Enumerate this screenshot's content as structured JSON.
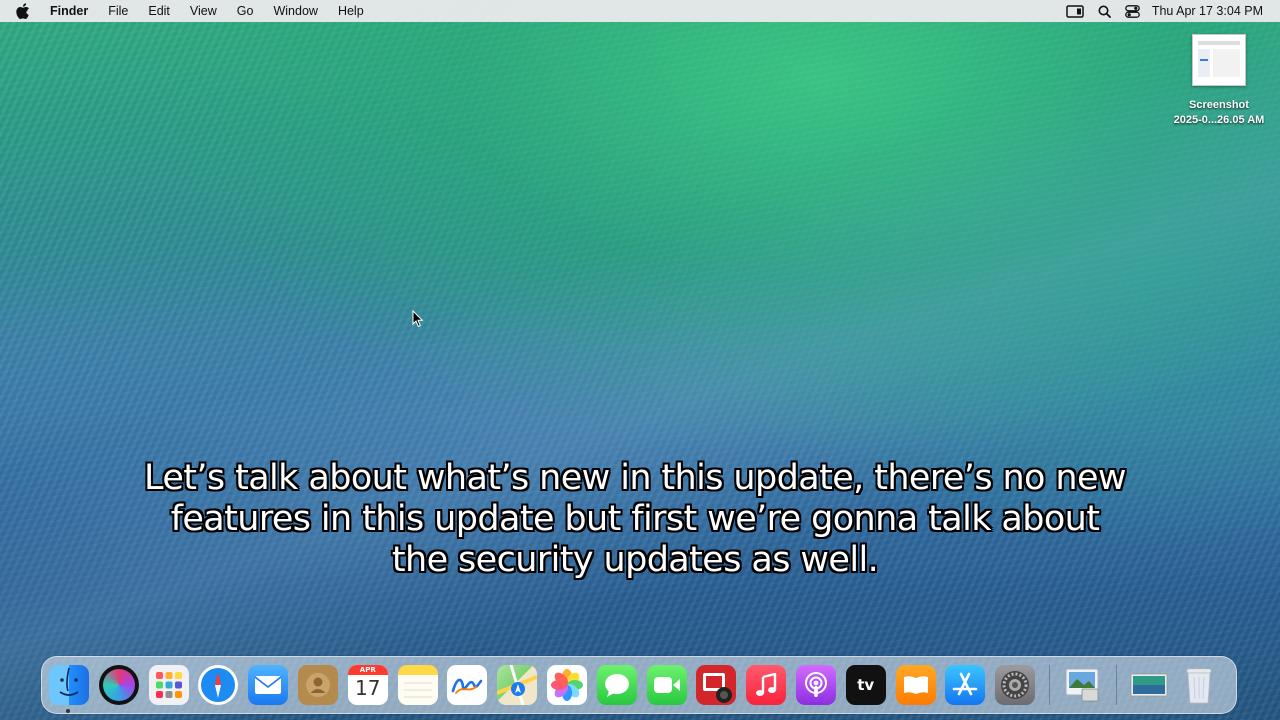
{
  "menubar": {
    "apple_icon": "apple-logo-icon",
    "app_name": "Finder",
    "items": [
      "File",
      "Edit",
      "View",
      "Go",
      "Window",
      "Help"
    ],
    "status_icons": [
      "screen-mirroring-icon",
      "spotlight-search-icon",
      "control-center-icon"
    ],
    "clock": "Thu Apr 17  3:04 PM"
  },
  "desktop": {
    "file": {
      "name_line1": "Screenshot",
      "name_line2": "2025-0...26.05 AM"
    }
  },
  "caption": {
    "text": "Let’s talk about what’s new in this update, there’s no new features in this update but first we’re gonna talk about the security updates as well."
  },
  "calendar": {
    "month": "APR",
    "day": "17"
  },
  "dock": {
    "apps": [
      {
        "name": "Finder",
        "icon": "finder-icon"
      },
      {
        "name": "Siri",
        "icon": "siri-icon"
      },
      {
        "name": "Launchpad",
        "icon": "launchpad-icon"
      },
      {
        "name": "Safari",
        "icon": "safari-icon"
      },
      {
        "name": "Mail",
        "icon": "mail-icon"
      },
      {
        "name": "Contacts",
        "icon": "contacts-icon"
      },
      {
        "name": "Calendar",
        "icon": "calendar-icon"
      },
      {
        "name": "Notes",
        "icon": "notes-icon"
      },
      {
        "name": "Freeform",
        "icon": "freeform-icon"
      },
      {
        "name": "Maps",
        "icon": "maps-icon"
      },
      {
        "name": "Photos",
        "icon": "photos-icon"
      },
      {
        "name": "Messages",
        "icon": "messages-icon"
      },
      {
        "name": "FaceTime",
        "icon": "facetime-icon"
      },
      {
        "name": "Photo Booth",
        "icon": "photo-booth-icon"
      },
      {
        "name": "Music",
        "icon": "music-icon"
      },
      {
        "name": "Podcasts",
        "icon": "podcasts-icon"
      },
      {
        "name": "TV",
        "icon": "apple-tv-icon"
      },
      {
        "name": "Books",
        "icon": "books-icon"
      },
      {
        "name": "App Store",
        "icon": "app-store-icon"
      },
      {
        "name": "System Settings",
        "icon": "system-settings-icon"
      },
      {
        "name": "Preview",
        "icon": "preview-icon"
      },
      {
        "name": "Desktop",
        "icon": "desktop-folder-icon"
      },
      {
        "name": "Trash",
        "icon": "trash-icon"
      }
    ],
    "tv_label": "tv"
  },
  "colors": {
    "menubar_bg": "#e8e8ea",
    "caption_text": "#ffffff",
    "caption_outline": "#000000"
  }
}
